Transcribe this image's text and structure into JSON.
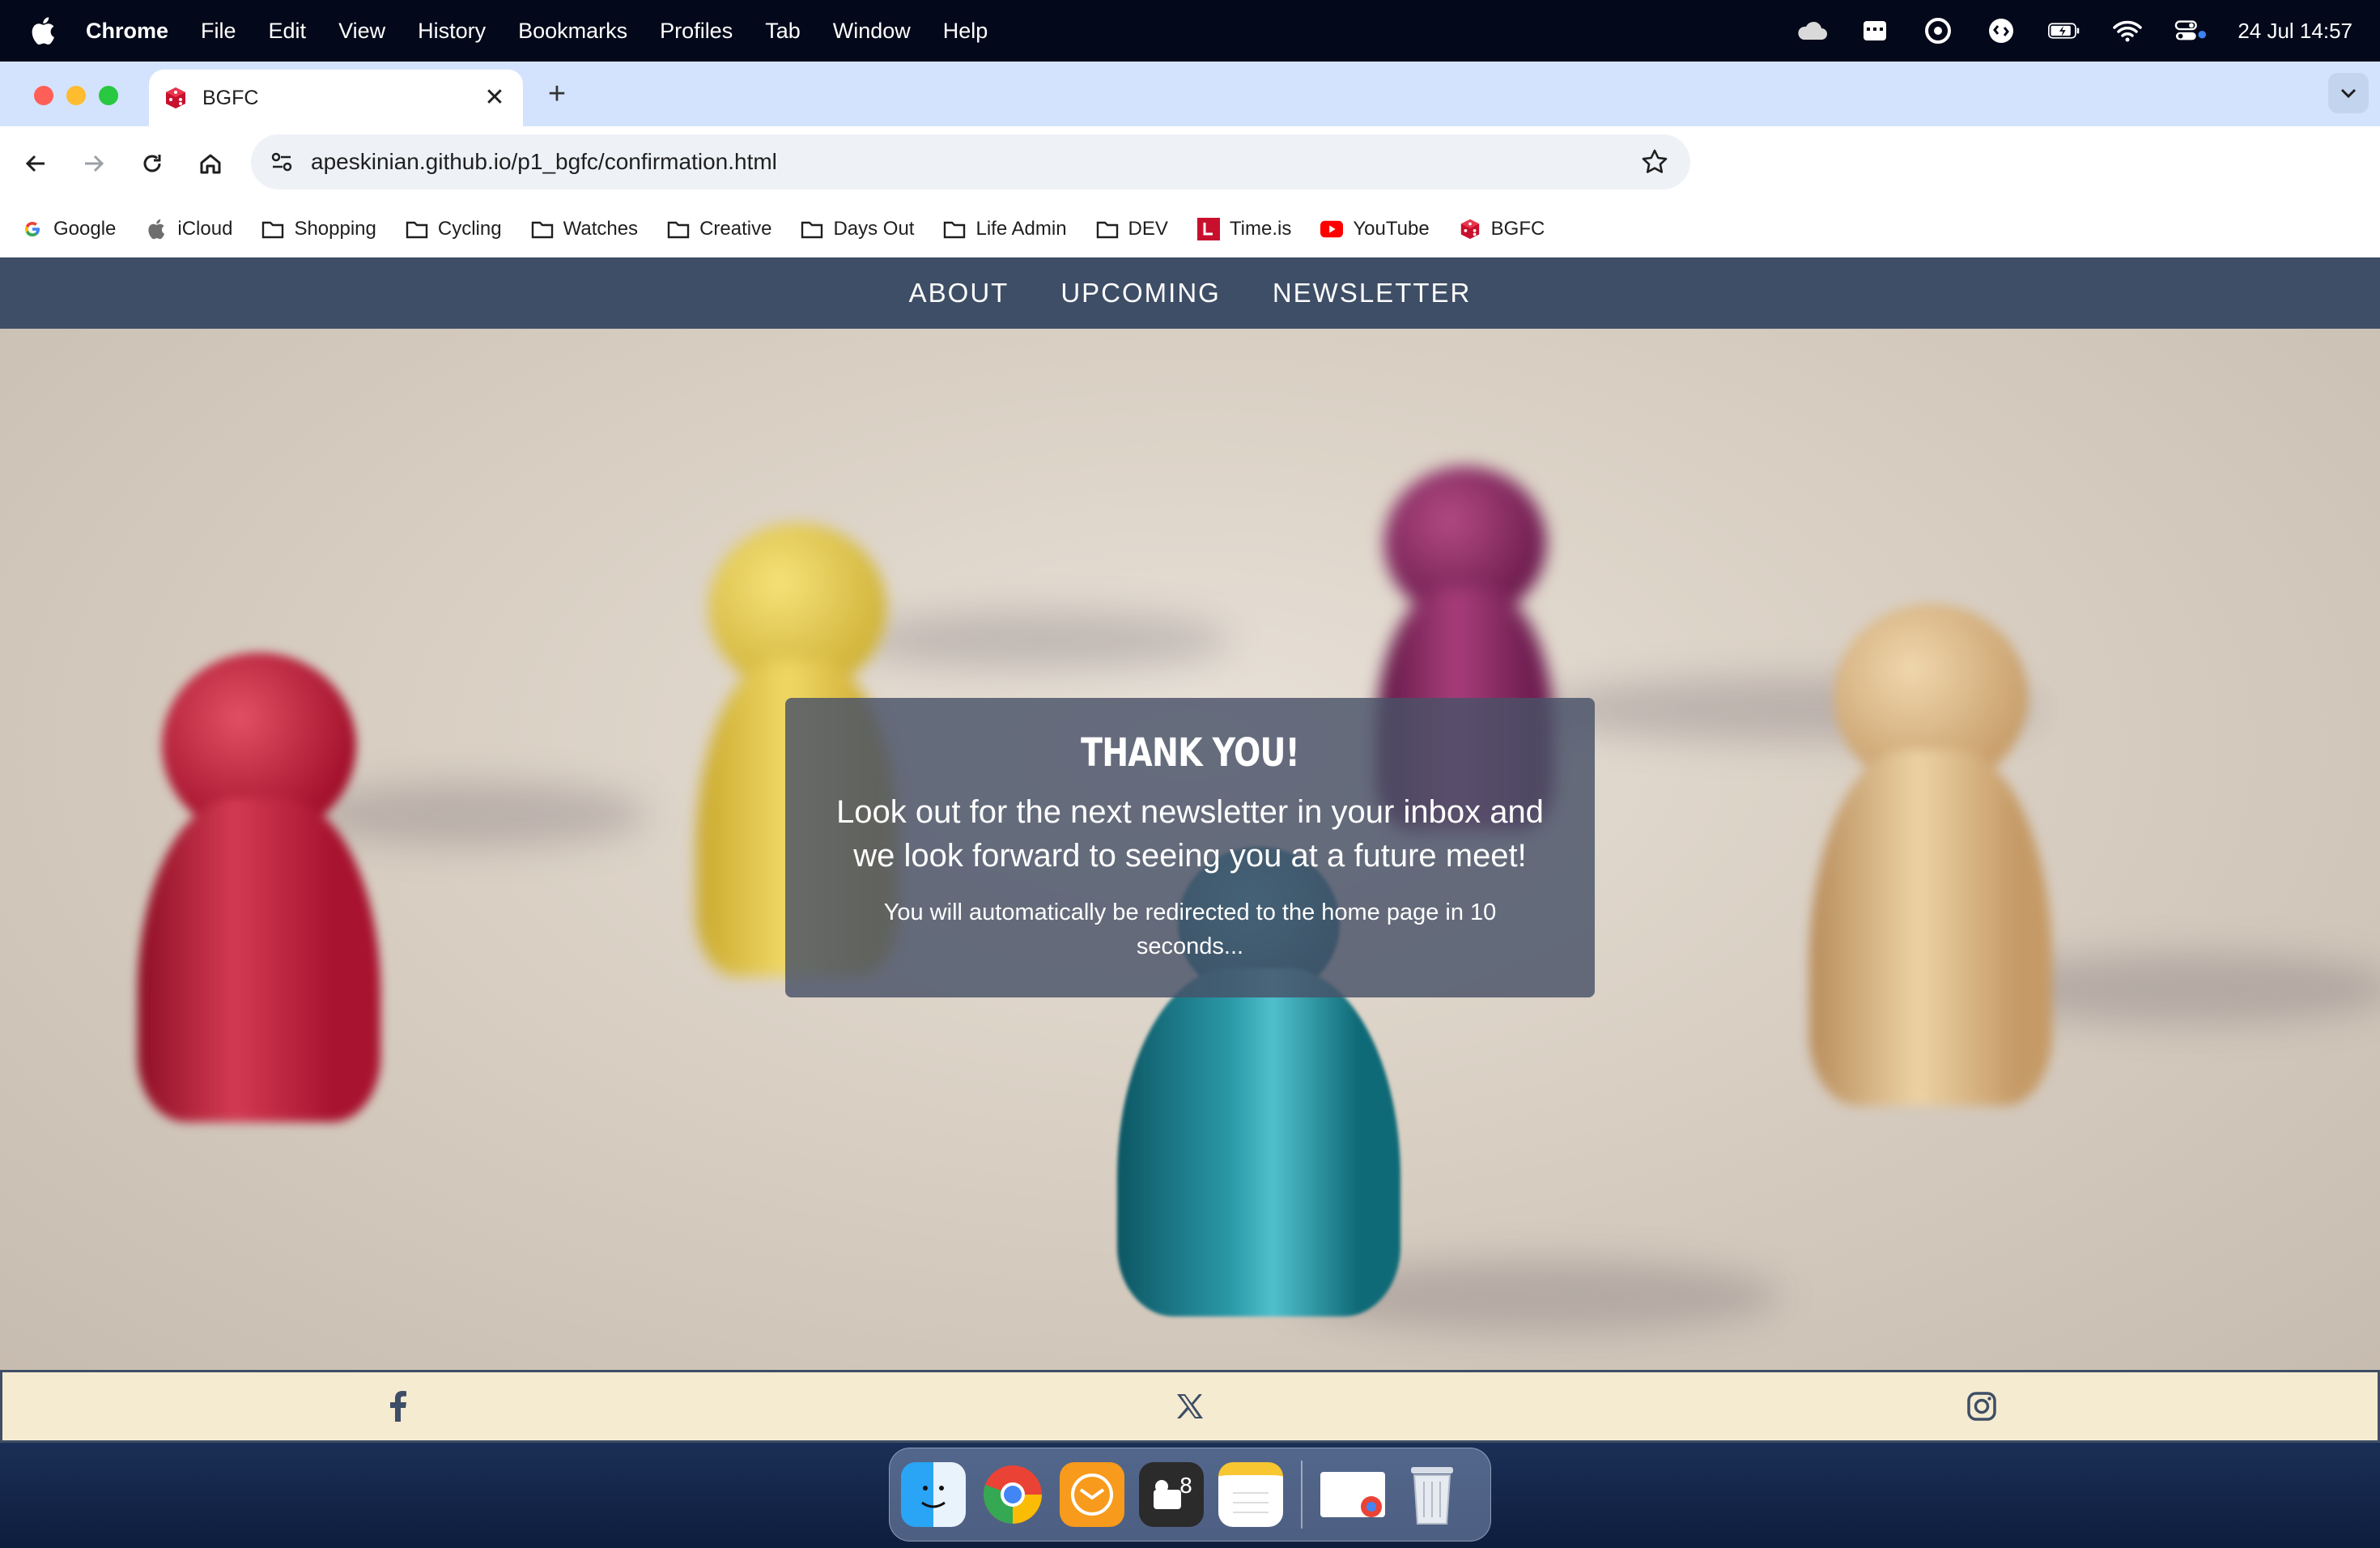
{
  "menubar": {
    "app_name": "Chrome",
    "items": [
      "File",
      "Edit",
      "View",
      "History",
      "Bookmarks",
      "Profiles",
      "Tab",
      "Window",
      "Help"
    ],
    "clock": "24 Jul  14:57"
  },
  "browser": {
    "tab": {
      "title": "BGFC"
    },
    "url": "apeskinian.github.io/p1_bgfc/confirmation.html",
    "bookmarks": [
      {
        "label": "Google",
        "icon": "google-icon"
      },
      {
        "label": "iCloud",
        "icon": "apple-icon"
      },
      {
        "label": "Shopping",
        "icon": "folder-icon"
      },
      {
        "label": "Cycling",
        "icon": "folder-icon"
      },
      {
        "label": "Watches",
        "icon": "folder-icon"
      },
      {
        "label": "Creative",
        "icon": "folder-icon"
      },
      {
        "label": "Days Out",
        "icon": "folder-icon"
      },
      {
        "label": "Life Admin",
        "icon": "folder-icon"
      },
      {
        "label": "DEV",
        "icon": "folder-icon"
      },
      {
        "label": "Time.is",
        "icon": "timeis-icon"
      },
      {
        "label": "YouTube",
        "icon": "youtube-icon"
      },
      {
        "label": "BGFC",
        "icon": "dice-icon"
      }
    ]
  },
  "site": {
    "nav": {
      "about": "ABOUT",
      "upcoming": "UPCOMING",
      "newsletter": "NEWSLETTER"
    },
    "confirmation": {
      "title": "THANK YOU!",
      "message": "Look out for the next newsletter in your inbox and we look forward to seeing you at a future meet!",
      "redirect": "You will automatically be redirected to the home page in 10 seconds..."
    },
    "footer": {
      "icons": [
        "facebook-icon",
        "x-icon",
        "instagram-icon"
      ]
    }
  },
  "colors": {
    "nav_bg": "#3e4e66",
    "footer_bg": "#f5ebd0",
    "tabstrip": "#d3e3fd"
  }
}
